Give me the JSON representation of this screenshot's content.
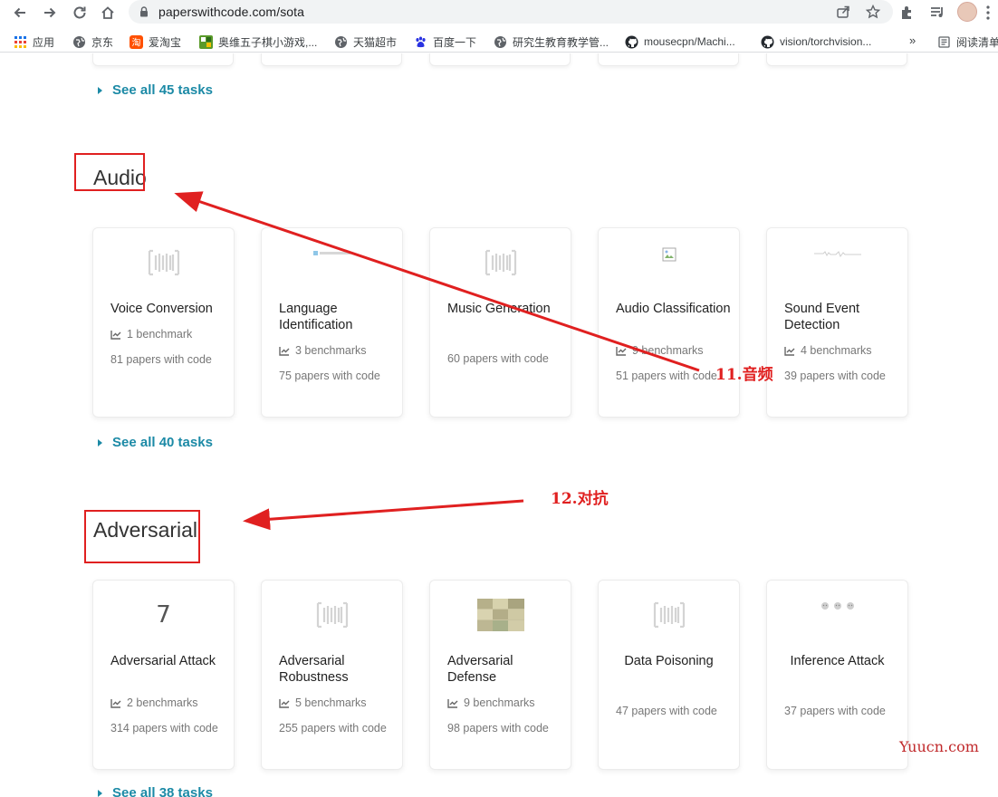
{
  "browser": {
    "url": "paperswithcode.com/sota",
    "bookmarks": [
      {
        "label": "应用",
        "icon": "apps-grid-icon",
        "color": "#5f6368"
      },
      {
        "label": "京东",
        "icon": "globe-icon",
        "color": "#5f6368"
      },
      {
        "label": "爱淘宝",
        "icon": "taobao-icon",
        "color": "#ff5000"
      },
      {
        "label": "奥维五子棋小游戏,...",
        "icon": "game-icon",
        "color": "#5a9a2a"
      },
      {
        "label": "天猫超市",
        "icon": "globe-icon",
        "color": "#5f6368"
      },
      {
        "label": "百度一下",
        "icon": "baidu-paw-icon",
        "color": "#2932e1"
      },
      {
        "label": "研究生教育教学管...",
        "icon": "globe-icon",
        "color": "#5f6368"
      },
      {
        "label": "mousecpn/Machi...",
        "icon": "github-icon",
        "color": "#24292e"
      },
      {
        "label": "vision/torchvision...",
        "icon": "github-icon",
        "color": "#24292e"
      }
    ],
    "more_label": "»",
    "reading_list": "阅读清单"
  },
  "page": {
    "top_see_all": "See all 45 tasks",
    "sections": [
      {
        "title": "Audio",
        "see_all": "See all 40 tasks",
        "cards": [
          {
            "name": "Voice Conversion",
            "benchmarks": "1 benchmark",
            "papers": "81 papers with code",
            "thumb": "barcode"
          },
          {
            "name": "Language Identification",
            "benchmarks": "3 benchmarks",
            "papers": "75 papers with code",
            "thumb": "tiny-image"
          },
          {
            "name": "Music Generation",
            "benchmarks": "",
            "papers": "60 papers with code",
            "thumb": "barcode"
          },
          {
            "name": "Audio Classification",
            "benchmarks": "9 benchmarks",
            "papers": "51 papers with code",
            "thumb": "broken-image"
          },
          {
            "name": "Sound Event Detection",
            "benchmarks": "4 benchmarks",
            "papers": "39 papers with code",
            "thumb": "tiny-waveform"
          }
        ]
      },
      {
        "title": "Adversarial",
        "see_all": "See all 38 tasks",
        "cards": [
          {
            "name": "Adversarial Attack",
            "benchmarks": "2 benchmarks",
            "papers": "314 papers with code",
            "thumb": "digit-seven"
          },
          {
            "name": "Adversarial Robustness",
            "benchmarks": "5 benchmarks",
            "papers": "255 papers with code",
            "thumb": "barcode"
          },
          {
            "name": "Adversarial Defense",
            "benchmarks": "9 benchmarks",
            "papers": "98 papers with code",
            "thumb": "image-grid"
          },
          {
            "name": "Data Poisoning",
            "benchmarks": "",
            "papers": "47 papers with code",
            "thumb": "barcode"
          },
          {
            "name": "Inference Attack",
            "benchmarks": "",
            "papers": "37 papers with code",
            "thumb": "cat-faces"
          }
        ]
      }
    ]
  },
  "annotations": {
    "audio_label": "11.音频",
    "adversarial_label": "12.对抗",
    "color": "#e02020"
  },
  "watermark": "Yuucn.com",
  "thumb_digit": "7"
}
